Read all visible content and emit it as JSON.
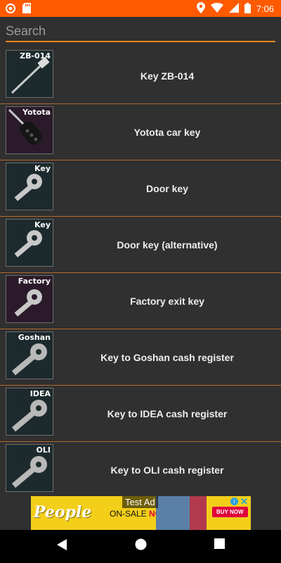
{
  "status_bar": {
    "time": "7:06",
    "icons": [
      "notification-dot-icon",
      "sd-card-icon",
      "location-icon",
      "wifi-icon",
      "signal-icon",
      "battery-icon"
    ]
  },
  "search": {
    "placeholder": "Search",
    "value": ""
  },
  "items": [
    {
      "tag": "ZB-014",
      "label": "Key ZB-014",
      "icon": "key-card-icon",
      "bg": "#1d2a2d"
    },
    {
      "tag": "Yotota",
      "label": "Yotota car key",
      "icon": "car-key-fob-icon",
      "bg": "#2a1a2a"
    },
    {
      "tag": "Key",
      "label": "Door key",
      "icon": "key-icon",
      "bg": "#1d2a2d"
    },
    {
      "tag": "Key",
      "label": "Door key (alternative)",
      "icon": "key-icon",
      "bg": "#1d2a2d"
    },
    {
      "tag": "Factory",
      "label": "Factory exit key",
      "icon": "key-icon",
      "bg": "#2a1a2a"
    },
    {
      "tag": "Goshan",
      "label": "Key to Goshan cash register",
      "icon": "key-icon",
      "bg": "#1d2a2d"
    },
    {
      "tag": "IDEA",
      "label": "Key to IDEA cash register",
      "icon": "key-icon",
      "bg": "#1d2a2d"
    },
    {
      "tag": "OLI",
      "label": "Key to OLI cash register",
      "icon": "key-icon",
      "bg": "#1d2a2d"
    }
  ],
  "ad": {
    "label": "Test Ad",
    "brand": "People",
    "promo_prefix": "ON-SALE ",
    "promo_emphasis": "NOW!",
    "cta": "BUY NOW"
  },
  "nav": {
    "icons": [
      "back-icon",
      "home-icon",
      "recents-icon"
    ]
  },
  "colors": {
    "accent": "#ff8a1a",
    "status_bar": "#ff5a00",
    "background": "#303030"
  }
}
